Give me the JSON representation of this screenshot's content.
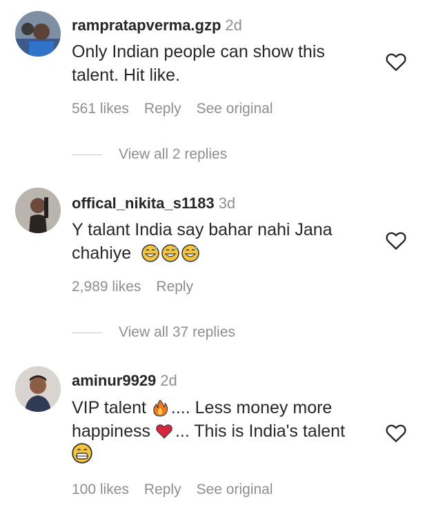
{
  "comments": [
    {
      "username": "rampratapverma.gzp",
      "time": "2d",
      "lines": [
        "Only Indian people can show this",
        "talent. Hit like."
      ],
      "likes": "561 likes",
      "reply": "Reply",
      "see_original": "See original",
      "view_replies": "View all 2 replies"
    },
    {
      "username": "offical_nikita_s1183",
      "time": "3d",
      "lines": [
        "Y talant India say bahar nahi Jana",
        "chahiye"
      ],
      "likes": "2,989 likes",
      "reply": "Reply",
      "view_replies": "View all 37 replies"
    },
    {
      "username": "aminur9929",
      "time": "2d",
      "line1_a": "VIP talent ",
      "line1_b": ".... Less money more",
      "line2_a": "happiness ",
      "line2_b": "... This is India's talent",
      "likes": "100 likes",
      "reply": "Reply",
      "see_original": "See original"
    }
  ],
  "icons": {
    "heart": "heart-outline-icon",
    "emoji_sweat": "grinning-face-with-sweat-icon",
    "emoji_fire": "fire-icon",
    "emoji_heart": "red-heart-icon",
    "emoji_grin": "grimacing-face-icon"
  },
  "colors": {
    "text": "#262626",
    "secondary": "#8e8e8e",
    "heart_red": "#e0245e"
  }
}
